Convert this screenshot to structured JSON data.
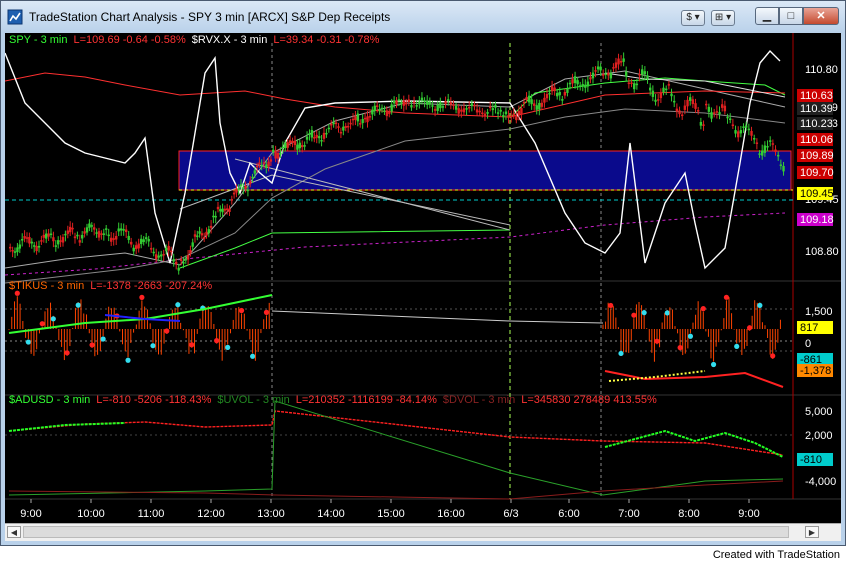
{
  "window": {
    "title": "TradeStation Chart Analysis - SPY 3 min [ARCX] S&P Dep Receipts",
    "btn_dollar": "$ ▾",
    "btn_grid": "⊞ ▾",
    "credit": "Created with TradeStation"
  },
  "colors": {
    "price_up": "#33cc33",
    "price_down": "#e02020",
    "rvx": "#ffffff",
    "highlight": "#0a0a8c",
    "tikus": "#ff4400",
    "adusd_up": "#22ff22",
    "adusd_down": "#ff2020"
  },
  "panes": {
    "price": {
      "symbol_label": "SPY - 3 min",
      "symbol_stats": "L=109.69  -0.64  -0.58%",
      "rvx_label": "$RVX.X - 3 min",
      "rvx_stats": "L=39.34  -0.31  -0.78%",
      "axis_ticks": [
        "110.80",
        "110.39",
        "110.23",
        "109.45",
        "108.80"
      ],
      "badges": [
        {
          "label": "110.63",
          "bg": "#cc0000",
          "fg": "#ffffff"
        },
        {
          "label": "110.39",
          "bg": "#202020",
          "fg": "#ffffff"
        },
        {
          "label": "110.23",
          "bg": "#202020",
          "fg": "#ffffff"
        },
        {
          "label": "110.06",
          "bg": "#cc0000",
          "fg": "#ffffff"
        },
        {
          "label": "109.89",
          "bg": "#cc0000",
          "fg": "#ffffff"
        },
        {
          "label": "109.70",
          "bg": "#cc0000",
          "fg": "#ffffff"
        },
        {
          "label": "109.45",
          "bg": "#ffff00",
          "fg": "#000000"
        },
        {
          "label": "109.18",
          "bg": "#cc00cc",
          "fg": "#ffffff"
        }
      ]
    },
    "tikus": {
      "label": "$TIKUS - 3 min",
      "stats": "L=-1378  -2663  -207.24%",
      "axis_ticks": [
        "1,500",
        "0"
      ],
      "badges": [
        {
          "label": "817",
          "bg": "#ffff00",
          "fg": "#000000"
        },
        {
          "label": "-861",
          "bg": "#00cccc",
          "fg": "#000000"
        },
        {
          "label": "-1,378",
          "bg": "#ff8800",
          "fg": "#000000"
        }
      ]
    },
    "adusd": {
      "label": "$ADUSD - 3 min",
      "stats": "L=-810  -5206  -118.43%",
      "uvol_label": "$UVOL - 3 min",
      "uvol_stats": "L=210352  -1116199  -84.14%",
      "dvol_label": "$DVOL - 3 min",
      "dvol_stats": "L=345830  278489  413.55%",
      "axis_ticks": [
        "5,000",
        "2,000",
        "-4,000"
      ],
      "badges": [
        {
          "label": "-810",
          "bg": "#00cccc",
          "fg": "#000000"
        }
      ]
    }
  },
  "time_axis": [
    "9:00",
    "10:00",
    "11:00",
    "12:00",
    "13:00",
    "14:00",
    "15:00",
    "16:00",
    "6/3",
    "6:00",
    "7:00",
    "8:00",
    "9:00"
  ]
}
